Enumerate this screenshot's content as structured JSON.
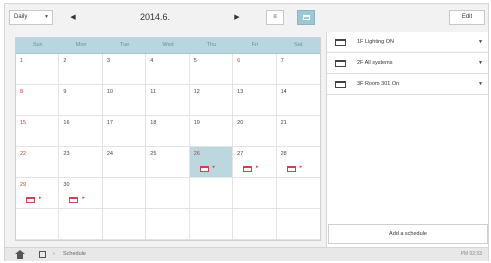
{
  "toolbar": {
    "view_select": "Daily",
    "prev_arrow": "◀",
    "month_title": "2014.6.",
    "next_arrow": "▶",
    "list_button": "≡",
    "edit_button": "Edit"
  },
  "calendar": {
    "weekdays": [
      "Sun",
      "Mon",
      "Tue",
      "Wed",
      "Thu",
      "Fri",
      "Sat"
    ],
    "cells": [
      {
        "day": "1",
        "red": true,
        "event": false,
        "today": false
      },
      {
        "day": "2",
        "red": false,
        "event": false,
        "today": false
      },
      {
        "day": "3",
        "red": false,
        "event": false,
        "today": false
      },
      {
        "day": "4",
        "red": false,
        "event": false,
        "today": false
      },
      {
        "day": "5",
        "red": false,
        "event": false,
        "today": false
      },
      {
        "day": "6",
        "red": true,
        "event": false,
        "today": false
      },
      {
        "day": "7",
        "red": false,
        "event": false,
        "today": false
      },
      {
        "day": "8",
        "red": true,
        "event": false,
        "today": false
      },
      {
        "day": "9",
        "red": false,
        "event": false,
        "today": false
      },
      {
        "day": "10",
        "red": false,
        "event": false,
        "today": false
      },
      {
        "day": "11",
        "red": false,
        "event": false,
        "today": false
      },
      {
        "day": "12",
        "red": false,
        "event": false,
        "today": false
      },
      {
        "day": "13",
        "red": false,
        "event": false,
        "today": false
      },
      {
        "day": "14",
        "red": false,
        "event": false,
        "today": false
      },
      {
        "day": "15",
        "red": true,
        "event": false,
        "today": false
      },
      {
        "day": "16",
        "red": false,
        "event": false,
        "today": false
      },
      {
        "day": "17",
        "red": false,
        "event": false,
        "today": false
      },
      {
        "day": "18",
        "red": false,
        "event": false,
        "today": false
      },
      {
        "day": "19",
        "red": false,
        "event": false,
        "today": false
      },
      {
        "day": "20",
        "red": false,
        "event": false,
        "today": false
      },
      {
        "day": "21",
        "red": false,
        "event": false,
        "today": false
      },
      {
        "day": "22",
        "red": true,
        "event": false,
        "today": false
      },
      {
        "day": "23",
        "red": false,
        "event": false,
        "today": false
      },
      {
        "day": "24",
        "red": false,
        "event": false,
        "today": false
      },
      {
        "day": "25",
        "red": false,
        "event": false,
        "today": false
      },
      {
        "day": "26",
        "red": true,
        "event": true,
        "today": true
      },
      {
        "day": "27",
        "red": false,
        "event": true,
        "today": false
      },
      {
        "day": "28",
        "red": false,
        "event": true,
        "today": false
      },
      {
        "day": "29",
        "red": true,
        "event": true,
        "today": false
      },
      {
        "day": "30",
        "red": false,
        "event": true,
        "today": false
      },
      {
        "day": "",
        "red": false,
        "event": false,
        "today": false
      },
      {
        "day": "",
        "red": false,
        "event": false,
        "today": false
      },
      {
        "day": "",
        "red": false,
        "event": false,
        "today": false
      },
      {
        "day": "",
        "red": false,
        "event": false,
        "today": false
      },
      {
        "day": "",
        "red": false,
        "event": false,
        "today": false
      },
      {
        "day": "",
        "red": false,
        "event": false,
        "today": false
      },
      {
        "day": "",
        "red": false,
        "event": false,
        "today": false
      },
      {
        "day": "",
        "red": false,
        "event": false,
        "today": false
      },
      {
        "day": "",
        "red": false,
        "event": false,
        "today": false
      },
      {
        "day": "",
        "red": false,
        "event": false,
        "today": false
      },
      {
        "day": "",
        "red": false,
        "event": false,
        "today": false
      },
      {
        "day": "",
        "red": false,
        "event": false,
        "today": false
      }
    ],
    "event_arrow": "▸",
    "colors": {
      "header": "#b7d6df",
      "today": "#bcd7de",
      "holiday": "#cc3333",
      "event": "#d04050"
    }
  },
  "schedules": [
    {
      "label": "1F Lighting ON",
      "arrow": "▼"
    },
    {
      "label": "2F All systems",
      "arrow": "▼"
    },
    {
      "label": "3F Room 301 On",
      "arrow": "▼"
    }
  ],
  "add_schedule_label": "Add a schedule",
  "statusbar": {
    "breadcrumb_sep": "›",
    "breadcrumb": "Schedule",
    "clock": "PM 02:33"
  }
}
